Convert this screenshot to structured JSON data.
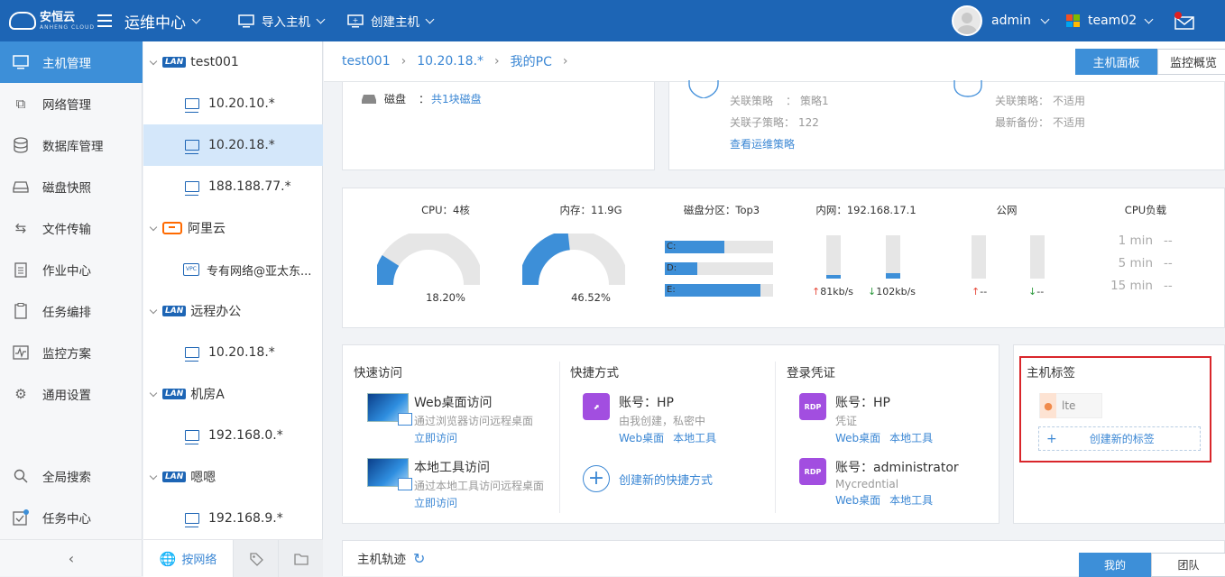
{
  "brand": {
    "name": "安恒云",
    "sub": "ANHENG CLOUD"
  },
  "topbar": {
    "menu": "运维中心",
    "import_host": "导入主机",
    "create_host": "创建主机",
    "user": "admin",
    "team": "team02"
  },
  "leftnav": {
    "items": [
      {
        "label": "主机管理"
      },
      {
        "label": "网络管理"
      },
      {
        "label": "数据库管理"
      },
      {
        "label": "磁盘快照"
      },
      {
        "label": "文件传输"
      },
      {
        "label": "作业中心"
      },
      {
        "label": "任务编排"
      },
      {
        "label": "监控方案"
      },
      {
        "label": "通用设置"
      }
    ],
    "search": "全局搜索",
    "tasks": "任务中心"
  },
  "tree": {
    "badge": "LAN",
    "nodes": [
      {
        "label": "test001"
      },
      {
        "label": "10.20.10.*"
      },
      {
        "label": "10.20.18.*"
      },
      {
        "label": "188.188.77.*"
      },
      {
        "label": "阿里云"
      },
      {
        "label": "专有网络@亚太东..."
      },
      {
        "label": "远程办公"
      },
      {
        "label": "10.20.18.*"
      },
      {
        "label": "机房A"
      },
      {
        "label": "192.168.0.*"
      },
      {
        "label": "嗯嗯"
      },
      {
        "label": "192.168.9.*"
      }
    ],
    "vpc_icon": "VPC",
    "footer_tab": "按网络"
  },
  "breadcrumb": [
    "test001",
    "10.20.18.*",
    "我的PC"
  ],
  "view_tabs": {
    "panel": "主机面板",
    "overview": "监控概览"
  },
  "info": {
    "disk_label": "磁盘",
    "disk_colon": "：",
    "disk_value": "共1块磁盘",
    "policy_label": "关联策略",
    "policy_value": "策略1",
    "subpolicy_label": "关联子策略：",
    "subpolicy_value": "122",
    "policy_link": "查看运维策略",
    "backup_policy_label": "关联策略：",
    "backup_policy_value": "不适用",
    "last_backup_label": "最新备份：",
    "last_backup_value": "不适用"
  },
  "metrics": {
    "cpu_title": "CPU：4核",
    "cpu_value": "18.20%",
    "cpu_fraction": 0.182,
    "mem_title": "内存：11.9G",
    "mem_value": "46.52%",
    "mem_fraction": 0.4652,
    "disk_title": "磁盘分区：Top3",
    "disks": [
      {
        "name": "C:",
        "fraction": 0.55
      },
      {
        "name": "D:",
        "fraction": 0.3
      },
      {
        "name": "E:",
        "fraction": 0.88
      }
    ],
    "lan_title": "内网：192.168.17.1",
    "lan_up": "81kb/s",
    "lan_down": "102kb/s",
    "lan_up_fraction": 0.08,
    "lan_down_fraction": 0.12,
    "wan_title": "公网",
    "wan_up": "--",
    "wan_down": "--",
    "up_arrow": "↑",
    "down_arrow": "↓",
    "load_title": "CPU负载",
    "load": [
      {
        "label": "1 min",
        "value": "--"
      },
      {
        "label": "5 min",
        "value": "--"
      },
      {
        "label": "15 min",
        "value": "--"
      }
    ]
  },
  "quick": {
    "title": "快速访问",
    "items": [
      {
        "name": "Web桌面访问",
        "desc": "通过浏览器访问远程桌面",
        "action": "立即访问"
      },
      {
        "name": "本地工具访问",
        "desc": "通过本地工具访问远程桌面",
        "action": "立即访问"
      }
    ]
  },
  "shortcut": {
    "title": "快捷方式",
    "account": "账号：HP",
    "desc": "由我创建，私密中",
    "web": "Web桌面",
    "local": "本地工具",
    "create": "创建新的快捷方式"
  },
  "credentials": {
    "title": "登录凭证",
    "icon": "RDP",
    "items": [
      {
        "account": "账号：HP",
        "desc": "凭证",
        "web": "Web桌面",
        "local": "本地工具"
      },
      {
        "account": "账号：administrator",
        "desc": "Mycredntial",
        "web": "Web桌面",
        "local": "本地工具"
      }
    ]
  },
  "tags": {
    "title": "主机标签",
    "tag": "lte",
    "create": "创建新的标签"
  },
  "track": {
    "title": "主机轨迹",
    "mine": "我的",
    "team": "团队"
  },
  "colors": {
    "primary": "#1d65b5",
    "accent": "#3d8fd8",
    "highlight": "#d9262b",
    "rdp": "#a24ee0"
  }
}
